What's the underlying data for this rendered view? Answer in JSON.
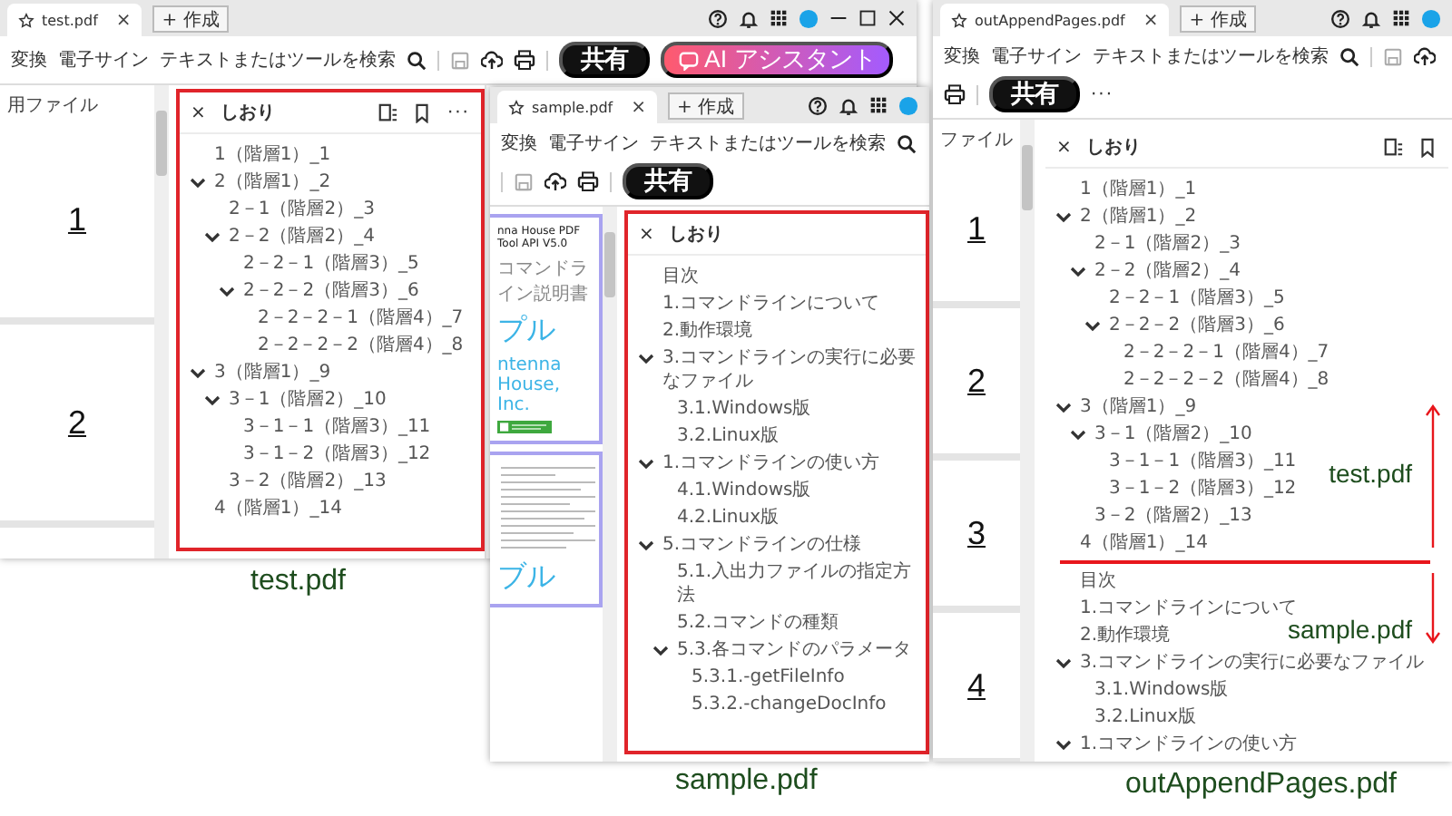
{
  "windows": [
    {
      "tab": {
        "title": "test.pdf",
        "close": "×"
      },
      "new_tab": "+ 作成",
      "window_controls": true,
      "caption": "test.pdf",
      "toolbar": {
        "items": [
          "変換",
          "電子サイン"
        ],
        "search": "テキストまたはツールを検索",
        "share": "共有",
        "ai": "AI アシスタント"
      },
      "document": {
        "kind": "pages",
        "heading": "用ファイル",
        "pages": [
          "1",
          "2"
        ]
      },
      "bookmarks": {
        "close": "×",
        "title": "しおり",
        "header_icons": true,
        "more": "···",
        "highlighted": true,
        "groups": [
          {
            "items": [
              {
                "text": "1（階層1）_1"
              },
              {
                "text": "2（階層1）_2",
                "expanded": true,
                "children": [
                  {
                    "text": "2－1（階層2）_3"
                  },
                  {
                    "text": "2－2（階層2）_4",
                    "expanded": true,
                    "children": [
                      {
                        "text": "2－2－1（階層3）_5"
                      },
                      {
                        "text": "2－2－2（階層3）_6",
                        "expanded": true,
                        "children": [
                          {
                            "text": "2－2－2－1（階層4）_7"
                          },
                          {
                            "text": "2－2－2－2（階層4）_8"
                          }
                        ]
                      }
                    ]
                  }
                ]
              },
              {
                "text": "3（階層1）_9",
                "expanded": true,
                "children": [
                  {
                    "text": "3－1（階層2）_10",
                    "expanded": true,
                    "children": [
                      {
                        "text": "3－1－1（階層3）_11"
                      },
                      {
                        "text": "3－1－2（階層3）_12"
                      }
                    ]
                  },
                  {
                    "text": "3－2（階層2）_13"
                  }
                ]
              },
              {
                "text": "4（階層1）_14"
              }
            ]
          }
        ]
      }
    },
    {
      "tab": {
        "title": "sample.pdf",
        "close": "×"
      },
      "new_tab": "+ 作成",
      "window_controls": false,
      "caption": "sample.pdf",
      "toolbar": {
        "items": [
          "変換",
          "電子サイン"
        ],
        "search": "テキストまたはツールを検索",
        "share": "共有"
      },
      "document": {
        "kind": "cover",
        "pages": [
          {
            "kind": "cover",
            "lines": [
              {
                "kind": "small",
                "text": "nna House PDF Tool API V5.0"
              },
              {
                "kind": "subtitle",
                "text": "コマンドライン説明書"
              },
              {
                "kind": "title",
                "text": "プル"
              },
              {
                "kind": "company",
                "text": "ntenna House, Inc."
              }
            ]
          },
          {
            "kind": "contents",
            "lines": [
              {
                "kind": "title",
                "text": "ブル"
              }
            ]
          }
        ]
      },
      "bookmarks": {
        "close": "×",
        "title": "しおり",
        "header_icons": false,
        "highlighted": true,
        "groups": [
          {
            "items": [
              {
                "text": "目次"
              },
              {
                "text": "1.コマンドラインについて"
              },
              {
                "text": "2.動作環境"
              },
              {
                "text": "3.コマンドラインの実行に必要なファイル",
                "expanded": true,
                "children": [
                  {
                    "text": "3.1.Windows版"
                  },
                  {
                    "text": "3.2.Linux版"
                  }
                ]
              },
              {
                "text": "1.コマンドラインの使い方",
                "expanded": true,
                "children": [
                  {
                    "text": "4.1.Windows版"
                  },
                  {
                    "text": "4.2.Linux版"
                  }
                ]
              },
              {
                "text": "5.コマンドラインの仕様",
                "expanded": true,
                "children": [
                  {
                    "text": "5.1.入出力ファイルの指定方法"
                  },
                  {
                    "text": "5.2.コマンドの種類"
                  },
                  {
                    "text": "5.3.各コマンドのパラメータ",
                    "expanded": true,
                    "children": [
                      {
                        "text": "5.3.1.-getFileInfo"
                      },
                      {
                        "text": "5.3.2.-changeDocInfo"
                      }
                    ]
                  }
                ]
              }
            ]
          }
        ]
      }
    },
    {
      "tab": {
        "title": "outAppendPages.pdf",
        "close": "×"
      },
      "new_tab": "+ 作成",
      "window_controls": false,
      "caption": "outAppendPages.pdf",
      "toolbar": {
        "items": [
          "変換",
          "電子サイン"
        ],
        "search": "テキストまたはツールを検索",
        "share": "共有",
        "more": "···"
      },
      "document": {
        "kind": "pages",
        "heading": "ファイル",
        "pages": [
          "1",
          "2",
          "3",
          "4"
        ]
      },
      "bookmarks": {
        "close": "×",
        "title": "しおり",
        "header_icons": true,
        "highlighted": false,
        "groups": [
          {
            "kind": "above",
            "label": "test.pdf",
            "items": [
              {
                "text": "1（階層1）_1"
              },
              {
                "text": "2（階層1）_2",
                "expanded": true,
                "children": [
                  {
                    "text": "2－1（階層2）_3"
                  },
                  {
                    "text": "2－2（階層2）_4",
                    "expanded": true,
                    "children": [
                      {
                        "text": "2－2－1（階層3）_5"
                      },
                      {
                        "text": "2－2－2（階層3）_6",
                        "expanded": true,
                        "children": [
                          {
                            "text": "2－2－2－1（階層4）_7"
                          },
                          {
                            "text": "2－2－2－2（階層4）_8"
                          }
                        ]
                      }
                    ]
                  }
                ]
              },
              {
                "text": "3（階層1）_9",
                "expanded": true,
                "children": [
                  {
                    "text": "3－1（階層2）_10",
                    "expanded": true,
                    "children": [
                      {
                        "text": "3－1－1（階層3）_11"
                      },
                      {
                        "text": "3－1－2（階層3）_12"
                      }
                    ]
                  },
                  {
                    "text": "3－2（階層2）_13"
                  }
                ]
              },
              {
                "text": "4（階層1）_14"
              }
            ]
          },
          {
            "kind": "below",
            "label": "sample.pdf",
            "items": [
              {
                "text": "目次"
              },
              {
                "text": "1.コマンドラインについて"
              },
              {
                "text": "2.動作環境"
              },
              {
                "text": "3.コマンドラインの実行に必要なファイル",
                "expanded": true,
                "children": [
                  {
                    "text": "3.1.Windows版"
                  },
                  {
                    "text": "3.2.Linux版"
                  }
                ]
              },
              {
                "text": "1.コマンドラインの使い方",
                "expanded": true
              }
            ]
          }
        ]
      }
    }
  ]
}
